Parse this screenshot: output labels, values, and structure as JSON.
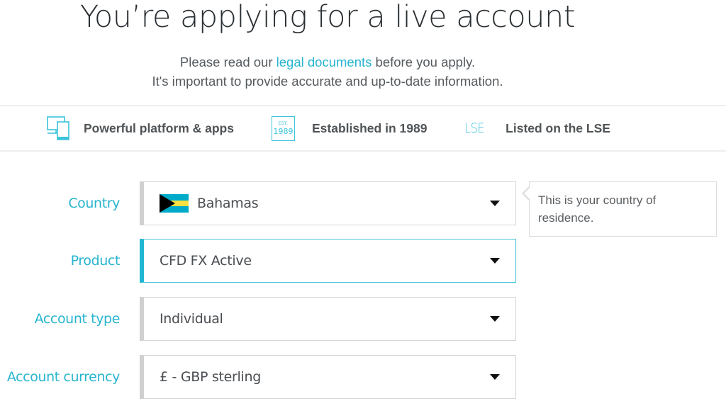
{
  "header": {
    "title": "You’re applying for a live account",
    "intro_before_link": "Please read our ",
    "intro_link": "legal documents",
    "intro_after_link": " before you apply.",
    "intro_line2": "It's important to provide accurate and up-to-date information."
  },
  "usps": [
    {
      "icon": "devices-icon",
      "label": "Powerful platform & apps"
    },
    {
      "icon": "established-badge-icon",
      "icon_text_top": "EST.",
      "icon_text_bottom": "1989",
      "label": "Established in 1989"
    },
    {
      "icon": "lse-icon",
      "icon_text": "LSE",
      "label": "Listed on the LSE"
    }
  ],
  "form": {
    "fields": [
      {
        "label": "Country",
        "value": "Bahamas",
        "flag": {
          "country": "Bahamas",
          "colors": [
            "#00abc9",
            "#fae042",
            "#00abc9",
            "#000000"
          ]
        }
      },
      {
        "label": "Product",
        "value": "CFD FX Active",
        "active": true
      },
      {
        "label": "Account type",
        "value": "Individual"
      },
      {
        "label": "Account currency",
        "value": "£ - GBP sterling"
      }
    ]
  },
  "tooltip": {
    "text": "This is your country of residence."
  },
  "colors": {
    "accent": "#27b4cf",
    "heading": "#2a2f33",
    "body_text": "#555a5e"
  }
}
